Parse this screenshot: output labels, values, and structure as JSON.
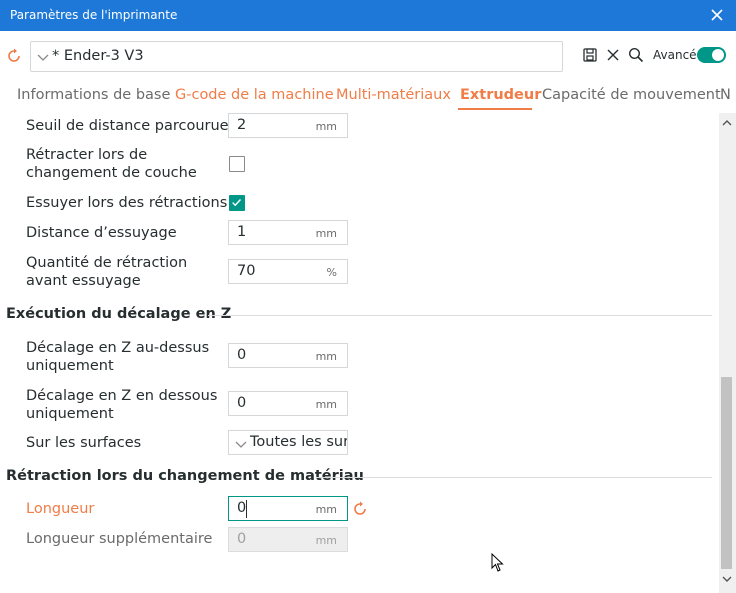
{
  "window": {
    "title": "Paramètres de l'imprimante"
  },
  "toolbar": {
    "preset_name": "* Ender-3 V3",
    "advanced_label": "Avancé",
    "advanced_on": true
  },
  "tabs": [
    {
      "label": "Informations de base",
      "state": "normal"
    },
    {
      "label": "G-code de la machine",
      "state": "modified"
    },
    {
      "label": "Multi-matériaux",
      "state": "modified"
    },
    {
      "label": "Extrudeur",
      "state": "active"
    },
    {
      "label": "Capacité de mouvement",
      "state": "normal"
    },
    {
      "label": "N",
      "state": "normal"
    }
  ],
  "fields": {
    "travel_threshold": {
      "label": "Seuil de distance parcourue",
      "value": "2",
      "unit": "mm"
    },
    "retract_layer_change": {
      "label_line1": "Rétracter lors de",
      "label_line2": "changement de couche",
      "checked": false
    },
    "wipe": {
      "label": "Essuyer lors des rétractions",
      "checked": true
    },
    "wipe_distance": {
      "label": "Distance d’essuyage",
      "value": "1",
      "unit": "mm"
    },
    "retract_before_wipe": {
      "label_line1": "Quantité de rétraction",
      "label_line2": "avant essuyage",
      "value": "70",
      "unit": "%"
    }
  },
  "z_hop": {
    "header": "Exécution du décalage en Z",
    "above": {
      "label_line1": "Décalage en Z au-dessus",
      "label_line2": "uniquement",
      "value": "0",
      "unit": "mm"
    },
    "below": {
      "label_line1": "Décalage en Z en dessous",
      "label_line2": "uniquement",
      "value": "0",
      "unit": "mm"
    },
    "surfaces": {
      "label": "Sur les surfaces",
      "value": "Toutes les surfaces"
    }
  },
  "material_change": {
    "header": "Rétraction lors du changement de matériau",
    "length": {
      "label": "Longueur",
      "value": "0",
      "unit": "mm"
    },
    "extra_length": {
      "label": "Longueur supplémentaire",
      "value": "0",
      "unit": "mm"
    }
  },
  "colors": {
    "titlebar": "#1e78d7",
    "accent": "#009688",
    "modified": "#f07c48"
  },
  "icons": {
    "close": "close-icon",
    "reset": "reset-arrow-icon",
    "save": "save-icon",
    "delete": "delete-x-icon",
    "search": "search-icon"
  }
}
